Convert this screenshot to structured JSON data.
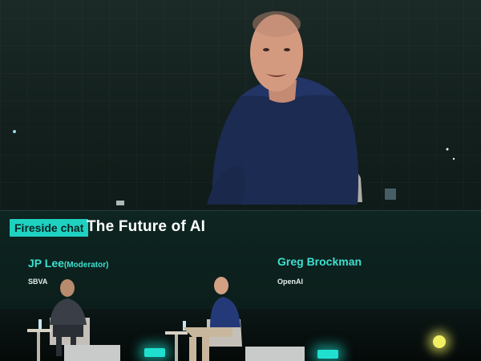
{
  "lower_third": {
    "tag": "Fireside chat",
    "title": "The Future of AI",
    "moderator": {
      "name": "JP Lee",
      "role": "(Moderator)",
      "org": "SBVA"
    },
    "guest": {
      "name": "Greg Brockman",
      "org": "OpenAI"
    }
  },
  "colors": {
    "accent_teal": "#1fd1c0",
    "name_teal": "#3ee0cf",
    "background": "#07120f"
  }
}
